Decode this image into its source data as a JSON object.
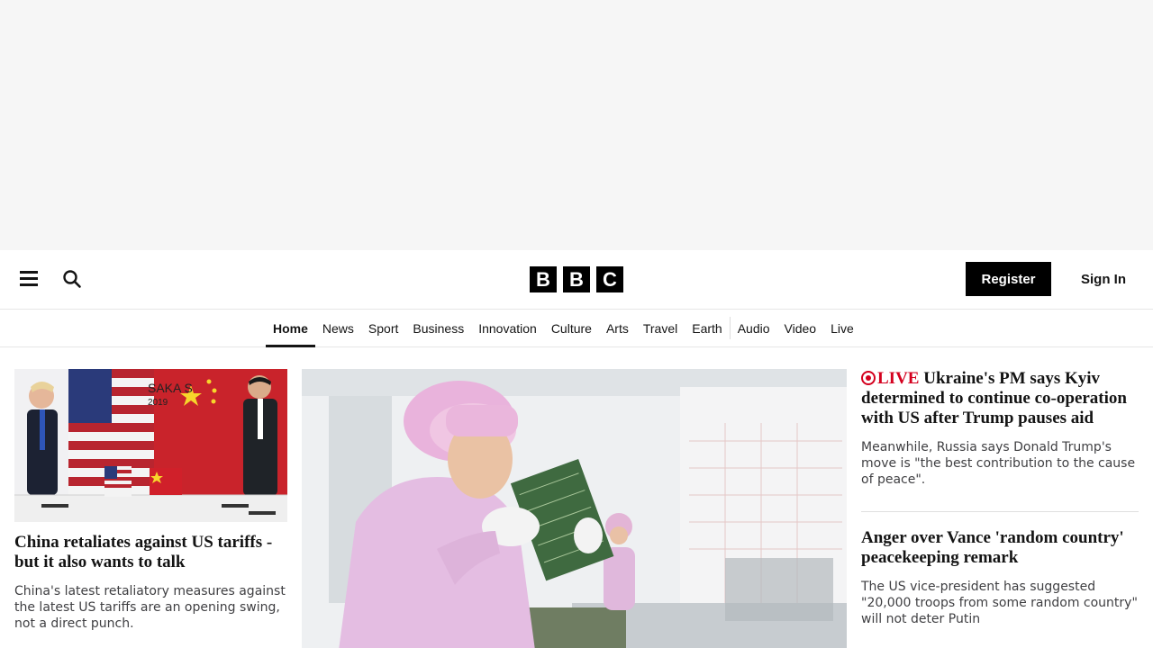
{
  "header": {
    "logo_letters": [
      "B",
      "B",
      "C"
    ],
    "register_label": "Register",
    "signin_label": "Sign In"
  },
  "nav": {
    "items": [
      "Home",
      "News",
      "Sport",
      "Business",
      "Innovation",
      "Culture",
      "Arts",
      "Travel",
      "Earth",
      "Audio",
      "Video",
      "Live"
    ],
    "active": "Home"
  },
  "stories": {
    "left": {
      "headline": "China retaliates against US tariffs - but it also wants to talk",
      "summary": "China's latest retaliatory measures against the latest US tariffs are an opening swing, not a direct punch."
    },
    "right_top": {
      "live_label": "LIVE",
      "headline": "Ukraine's PM says Kyiv determined to continue co-operation with US after Trump pauses aid",
      "summary": "Meanwhile, Russia says Donald Trump's move is \"the best contribution to the cause of peace\"."
    },
    "right_second": {
      "headline": "Anger over Vance 'random country' peacekeeping remark",
      "summary": "The US vice-president has suggested \"20,000 troops from some random country\" will not deter Putin"
    }
  },
  "image_text": {
    "backdrop_text": "SAKA S",
    "backdrop_year": "2019"
  },
  "colors": {
    "accent_live": "#d4001e",
    "brand": "#000000"
  }
}
